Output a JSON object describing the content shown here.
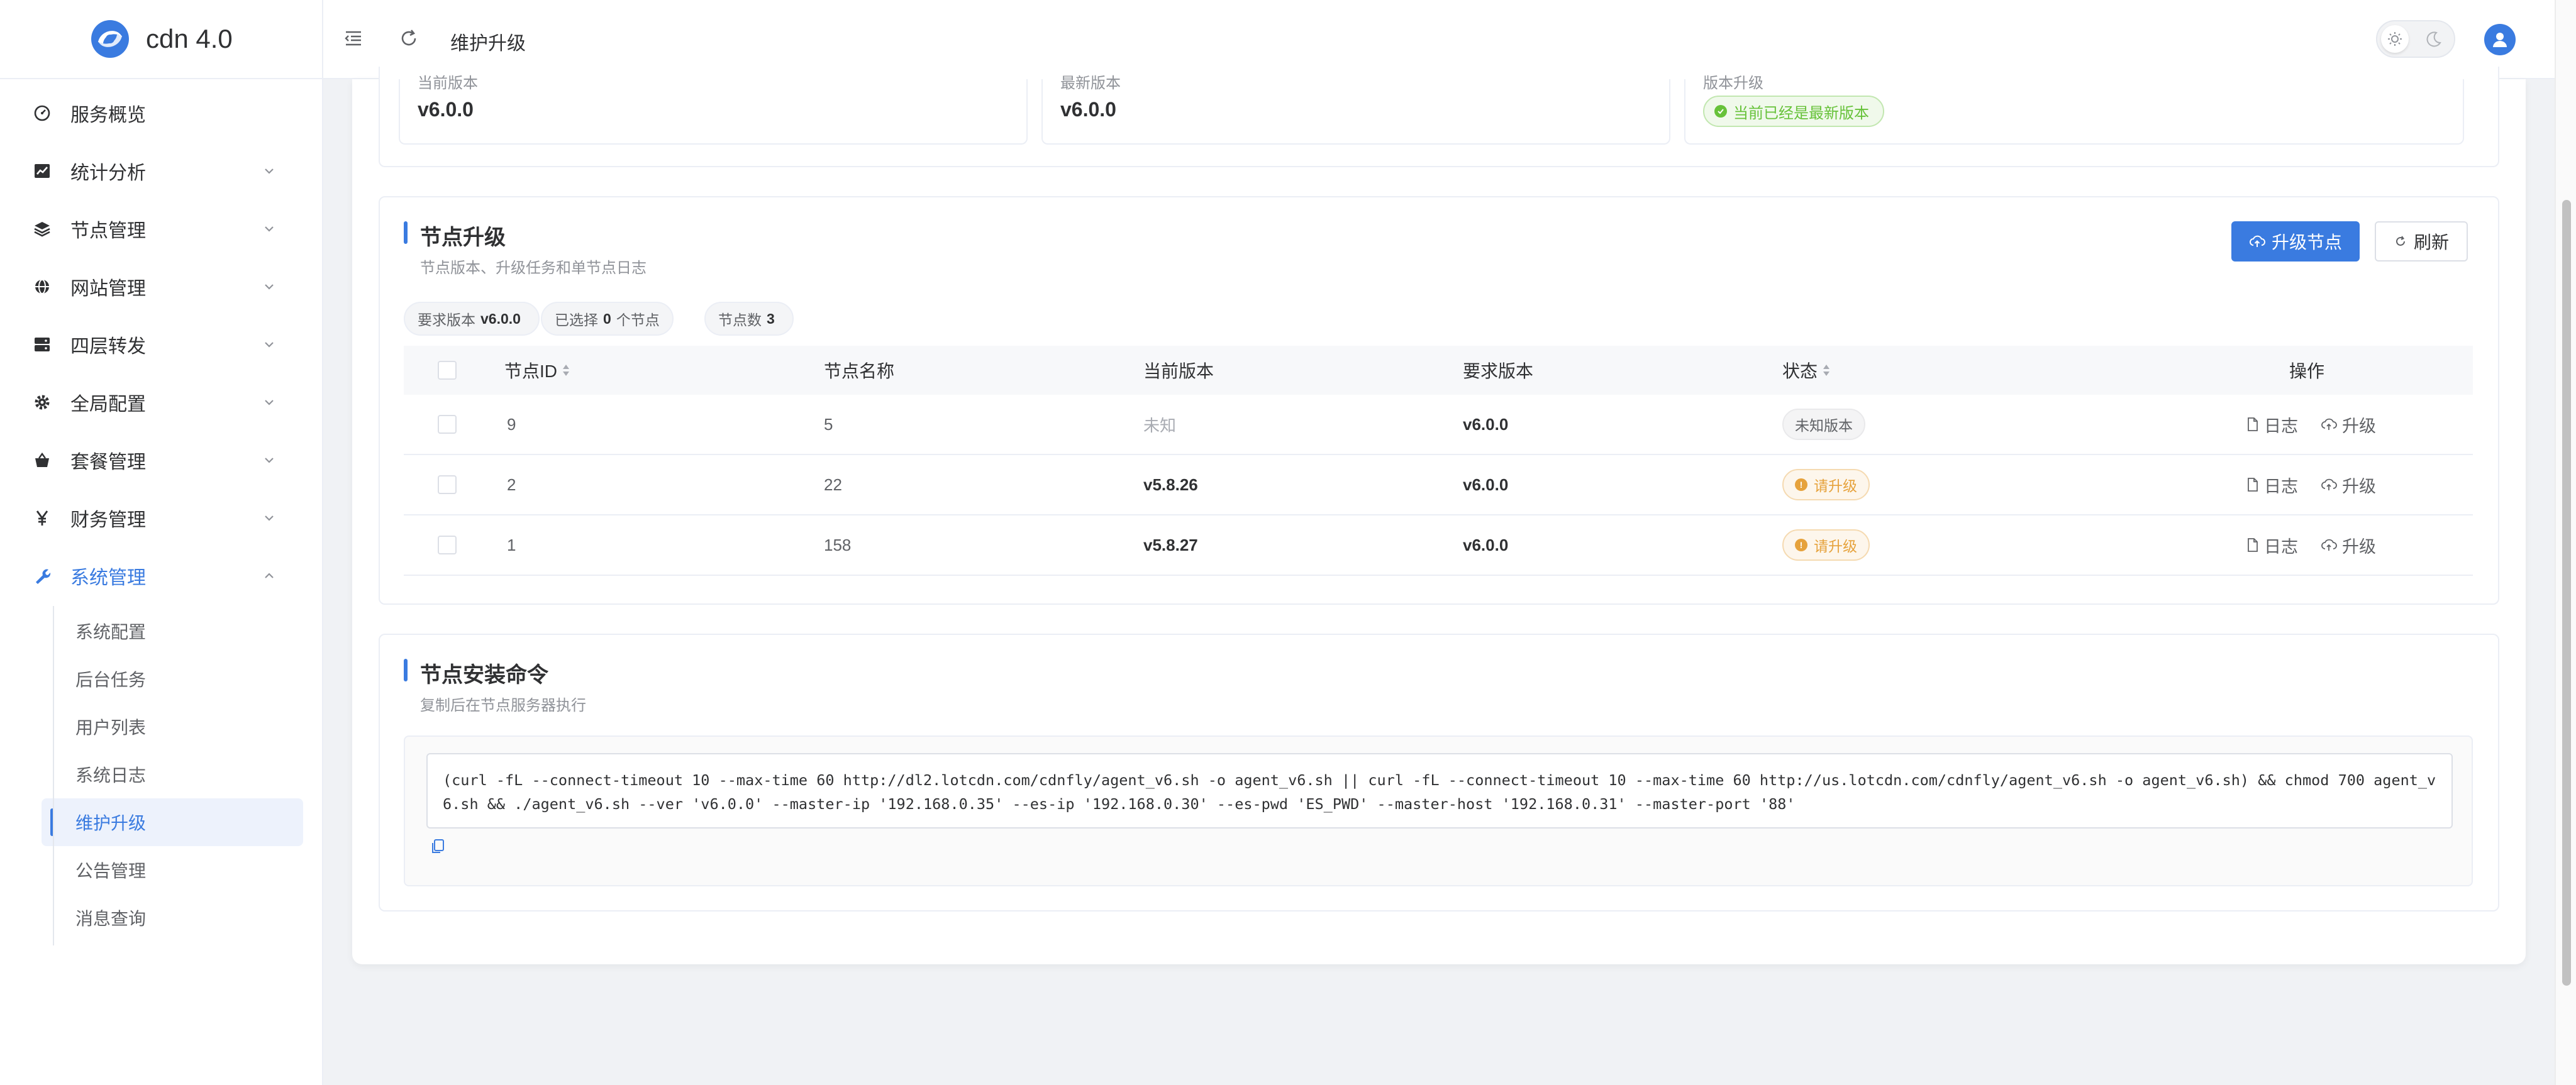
{
  "app": {
    "name": "cdn 4.0"
  },
  "sidebar": {
    "items": [
      {
        "label": "服务概览",
        "icon": "dashboard-icon"
      },
      {
        "label": "统计分析",
        "icon": "chart-icon"
      },
      {
        "label": "节点管理",
        "icon": "layers-icon"
      },
      {
        "label": "网站管理",
        "icon": "globe-icon"
      },
      {
        "label": "四层转发",
        "icon": "server-icon"
      },
      {
        "label": "全局配置",
        "icon": "gear-icon"
      },
      {
        "label": "套餐管理",
        "icon": "basket-icon"
      },
      {
        "label": "财务管理",
        "icon": "yen-icon"
      },
      {
        "label": "系统管理",
        "icon": "wrench-icon"
      }
    ],
    "submenu": [
      {
        "label": "系统配置"
      },
      {
        "label": "后台任务"
      },
      {
        "label": "用户列表"
      },
      {
        "label": "系统日志"
      },
      {
        "label": "维护升级"
      },
      {
        "label": "公告管理"
      },
      {
        "label": "消息查询"
      }
    ]
  },
  "header": {
    "title": "维护升级"
  },
  "version_panel": {
    "current_label": "当前版本",
    "current_value": "v6.0.0",
    "latest_label": "最新版本",
    "latest_value": "v6.0.0",
    "status_label": "版本升级",
    "status_text": "当前已经是最新版本"
  },
  "node_upgrade": {
    "title": "节点升级",
    "subtitle": "节点版本、升级任务和单节点日志",
    "upgrade_button": "升级节点",
    "refresh_button": "刷新",
    "pills": {
      "required_label": "要求版本",
      "required_value": "v6.0.0",
      "selected_label": "已选择",
      "selected_value": "0",
      "selected_unit": "个节点",
      "count_label": "节点数",
      "count_value": "3"
    },
    "columns": {
      "id": "节点ID",
      "name": "节点名称",
      "current": "当前版本",
      "required": "要求版本",
      "status": "状态",
      "actions": "操作"
    },
    "action_labels": {
      "log": "日志",
      "upgrade": "升级"
    },
    "rows": [
      {
        "id": "9",
        "name": "5",
        "current": "未知",
        "required": "v6.0.0",
        "status": "未知版本",
        "status_kind": "grey"
      },
      {
        "id": "2",
        "name": "22",
        "current": "v5.8.26",
        "required": "v6.0.0",
        "status": "请升级",
        "status_kind": "warn"
      },
      {
        "id": "1",
        "name": "158",
        "current": "v5.8.27",
        "required": "v6.0.0",
        "status": "请升级",
        "status_kind": "warn"
      }
    ]
  },
  "install": {
    "title": "节点安装命令",
    "subtitle": "复制后在节点服务器执行",
    "command": "(curl -fL --connect-timeout 10 --max-time 60 http://dl2.lotcdn.com/cdnfly/agent_v6.sh -o agent_v6.sh || curl -fL --connect-timeout 10 --max-time 60 http://us.lotcdn.com/cdnfly/agent_v6.sh -o agent_v6.sh) && chmod 700 agent_v6.sh && ./agent_v6.sh --ver 'v6.0.0' --master-ip '192.168.0.35' --es-ip '192.168.0.30' --es-pwd 'ES_PWD' --master-host '192.168.0.31' --master-port '88'"
  },
  "colors": {
    "accent": "#3a7be0",
    "success": "#67c23a",
    "warning": "#e6a23c"
  }
}
